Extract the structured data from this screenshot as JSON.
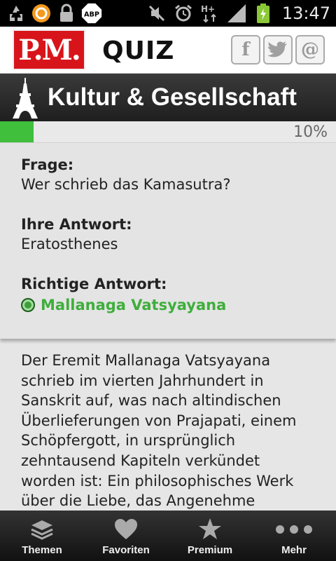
{
  "status_bar": {
    "icons": [
      "recycle-icon",
      "orange-circle-icon",
      "lock-icon",
      "adblock-icon",
      "mute-icon",
      "alarm-icon",
      "network-hplus-icon",
      "signal-icon",
      "battery-charging-icon"
    ],
    "abp_label": "ABP",
    "network_label": "H+",
    "time": "13:47"
  },
  "header": {
    "logo_text": "P.M.",
    "title": "QUIZ",
    "social": [
      {
        "icon": "facebook-icon",
        "glyph": "f"
      },
      {
        "icon": "twitter-icon",
        "glyph": "t"
      },
      {
        "icon": "email-icon",
        "glyph": "@"
      }
    ]
  },
  "category": {
    "icon": "eiffel-tower-icon",
    "title": "Kultur & Gesellschaft"
  },
  "progress": {
    "value": 0.1,
    "label": "10%",
    "color": "#3fbf3c"
  },
  "card": {
    "question_label": "Frage:",
    "question": "Wer schrieb das Kamasutra?",
    "your_answer_label": "Ihre Antwort:",
    "your_answer": "Eratosthenes",
    "correct_answer_label": "Richtige Antwort:",
    "correct_answer": "Mallanaga Vatsyayana",
    "correct_color": "#3fae3c"
  },
  "explanation": "Der Eremit Mallanaga Vatsyayana schrieb im vierten Jahrhundert in Sanskrit auf, was nach altindischen Überlieferungen von Prajapati, einem Schöpfergott, in ursprünglich zehntausend Kapiteln verkündet worden ist: Ein philosophisches Werk über die Liebe, das Angenehme",
  "nav": {
    "items": [
      {
        "label": "Themen",
        "icon": "layers-icon"
      },
      {
        "label": "Favoriten",
        "icon": "heart-icon"
      },
      {
        "label": "Premium",
        "icon": "star-icon"
      },
      {
        "label": "Mehr",
        "icon": "more-dots-icon"
      }
    ]
  }
}
